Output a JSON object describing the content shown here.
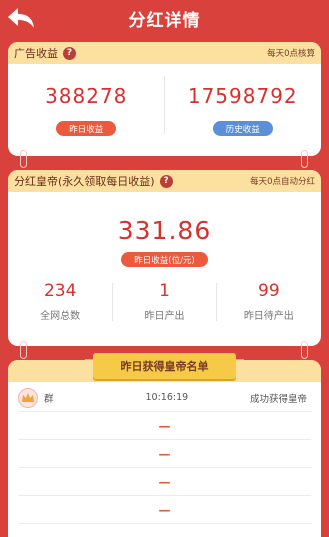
{
  "header": {
    "title": "分红详情"
  },
  "ad_income": {
    "title": "广告收益",
    "note": "每天0点核算",
    "yesterday": {
      "value": "388278",
      "label": "昨日收益"
    },
    "history": {
      "value": "17598792",
      "label": "历史收益"
    }
  },
  "dividend": {
    "title": "分红皇帝(永久领取每日收益)",
    "note": "每天0点自动分红",
    "main_value": "331.86",
    "main_label": "昨日收益(位/元)",
    "stats": [
      {
        "value": "234",
        "label": "全网总数"
      },
      {
        "value": "1",
        "label": "昨日产出"
      },
      {
        "value": "99",
        "label": "昨日待产出"
      }
    ]
  },
  "list": {
    "banner": "昨日获得皇帝名单",
    "rows": [
      {
        "name": "群",
        "time": "10:16:19",
        "status": "成功获得皇帝"
      },
      {
        "dash": "—"
      },
      {
        "dash": "—"
      },
      {
        "dash": "—"
      },
      {
        "dash": "—"
      }
    ]
  },
  "colors": {
    "background": "#d9423c",
    "accent_red": "#d9302d",
    "header_bar": "#fbe0a0",
    "blue_pill": "#5b8fd8"
  }
}
